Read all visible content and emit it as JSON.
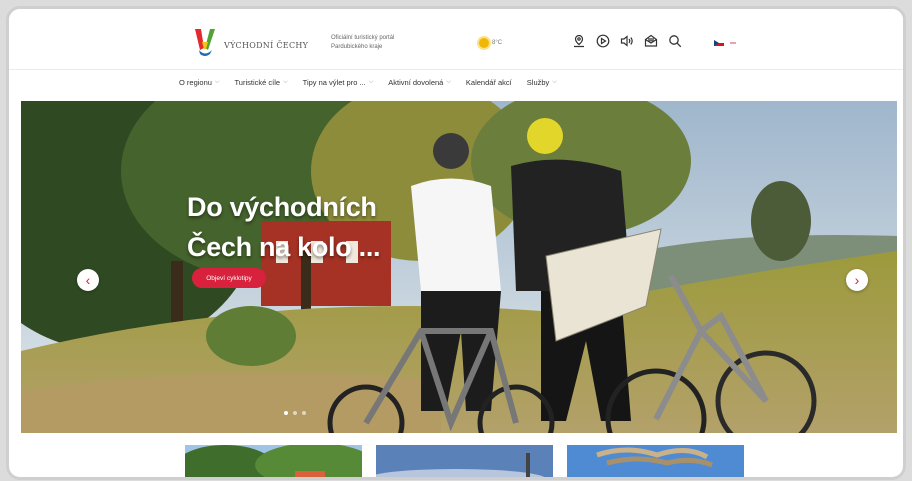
{
  "header": {
    "logo_text": "VÝCHODNÍ ČECHY",
    "tagline_line1": "Oficiální turistický portál",
    "tagline_line2": "Pardubického kraje",
    "weather": "8°C",
    "icons": [
      "map-marker-icon",
      "play-circle-icon",
      "speaker-icon",
      "mail-icon",
      "search-icon"
    ],
    "language": "cs"
  },
  "nav": {
    "items": [
      {
        "label": "O regionu",
        "has_dropdown": true
      },
      {
        "label": "Turistické cíle",
        "has_dropdown": true
      },
      {
        "label": "Tipy na výlet pro ...",
        "has_dropdown": true
      },
      {
        "label": "Aktivní dovolená",
        "has_dropdown": true
      },
      {
        "label": "Kalendář akcí",
        "has_dropdown": false
      },
      {
        "label": "Služby",
        "has_dropdown": true
      }
    ]
  },
  "hero": {
    "title_line1": "Do východních",
    "title_line2": "Čech na kolo ...",
    "button_label": "Objeví cyklotipy",
    "prev_arrow": "‹",
    "next_arrow": "›"
  },
  "colors": {
    "accent": "#d7213d",
    "logo_red": "#e4282e",
    "logo_yellow": "#f3c315",
    "logo_green": "#52a335",
    "logo_blue": "#1e6db3"
  }
}
